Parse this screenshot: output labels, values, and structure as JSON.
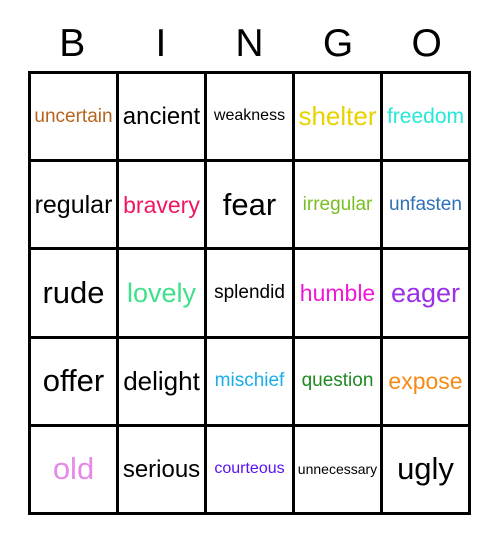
{
  "card": {
    "title": "BINGO",
    "headers": [
      "B",
      "I",
      "N",
      "G",
      "O"
    ],
    "columns": 5,
    "rows": 5,
    "border_color": "#000000",
    "background_color": "#ffffff"
  },
  "cells": [
    {
      "text": "uncertain",
      "color": "#B5651D",
      "size": "sz-sm",
      "column": "B",
      "row": 1
    },
    {
      "text": "ancient",
      "color": "#000000",
      "size": "sz-lg",
      "column": "I",
      "row": 1
    },
    {
      "text": "weakness",
      "color": "#000000",
      "size": "sz-xs",
      "column": "N",
      "row": 1
    },
    {
      "text": "shelter",
      "color": "#E8D200",
      "size": "sz-lg",
      "column": "G",
      "row": 1
    },
    {
      "text": "freedom",
      "color": "#25E8D8",
      "size": "sz-md",
      "column": "O",
      "row": 1
    },
    {
      "text": "regular",
      "color": "#000000",
      "size": "sz-lg",
      "column": "B",
      "row": 2
    },
    {
      "text": "bravery",
      "color": "#F0175E",
      "size": "sz-md",
      "column": "I",
      "row": 2
    },
    {
      "text": "fear",
      "color": "#000000",
      "size": "sz-xl",
      "column": "N",
      "row": 2
    },
    {
      "text": "irregular",
      "color": "#78BE20",
      "size": "sz-sm",
      "column": "G",
      "row": 2
    },
    {
      "text": "unfasten",
      "color": "#2F6FB5",
      "size": "sz-sm",
      "column": "O",
      "row": 2
    },
    {
      "text": "rude",
      "color": "#000000",
      "size": "sz-xl",
      "column": "B",
      "row": 3
    },
    {
      "text": "lovely",
      "color": "#3FE08A",
      "size": "sz-lg",
      "column": "I",
      "row": 3
    },
    {
      "text": "splendid",
      "color": "#000000",
      "size": "sz-sm",
      "column": "N",
      "row": 3
    },
    {
      "text": "humble",
      "color": "#F018D8",
      "size": "sz-md",
      "column": "G",
      "row": 3
    },
    {
      "text": "eager",
      "color": "#9B30E8",
      "size": "sz-lg",
      "column": "O",
      "row": 3
    },
    {
      "text": "offer",
      "color": "#000000",
      "size": "sz-xl",
      "column": "B",
      "row": 4
    },
    {
      "text": "delight",
      "color": "#000000",
      "size": "sz-lg",
      "column": "I",
      "row": 4
    },
    {
      "text": "mischief",
      "color": "#19AEE8",
      "size": "sz-sm",
      "column": "N",
      "row": 4
    },
    {
      "text": "question",
      "color": "#1E8A20",
      "size": "sz-sm",
      "column": "G",
      "row": 4
    },
    {
      "text": "expose",
      "color": "#F58A14",
      "size": "sz-md",
      "column": "O",
      "row": 4
    },
    {
      "text": "old",
      "color": "#E58AE8",
      "size": "sz-xl",
      "column": "B",
      "row": 5
    },
    {
      "text": "serious",
      "color": "#000000",
      "size": "sz-lg",
      "column": "I",
      "row": 5
    },
    {
      "text": "courteous",
      "color": "#5A12EE",
      "size": "sz-xs",
      "column": "N",
      "row": 5
    },
    {
      "text": "unnecessary",
      "color": "#000000",
      "size": "sz-xxs",
      "column": "G",
      "row": 5
    },
    {
      "text": "ugly",
      "color": "#000000",
      "size": "sz-xl",
      "column": "O",
      "row": 5
    }
  ]
}
